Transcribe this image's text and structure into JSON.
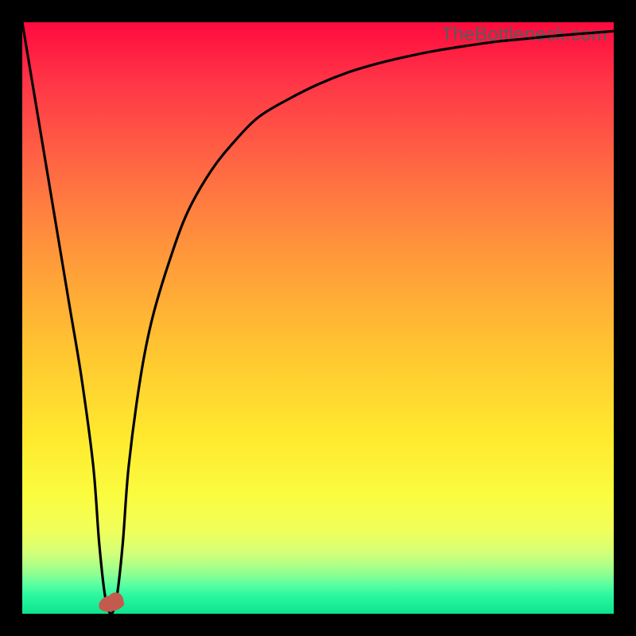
{
  "watermark": {
    "text": "TheBottleneck.com"
  },
  "chart_data": {
    "type": "line",
    "title": "",
    "xlabel": "",
    "ylabel": "",
    "xlim": [
      0,
      100
    ],
    "ylim": [
      0,
      100
    ],
    "grid": false,
    "legend": false,
    "background": "vertical gradient red→orange→yellow→green",
    "series": [
      {
        "name": "bottleneck-curve",
        "x": [
          0,
          2,
          4,
          6,
          8,
          10,
          12,
          13,
          14,
          15,
          16,
          17,
          18,
          20,
          22,
          25,
          28,
          32,
          36,
          40,
          45,
          50,
          55,
          60,
          65,
          70,
          75,
          80,
          85,
          90,
          95,
          100
        ],
        "y": [
          100,
          88,
          76,
          64,
          52,
          40,
          25,
          12,
          3,
          0,
          3,
          12,
          25,
          40,
          50,
          60,
          68,
          75,
          80,
          84,
          87,
          89.5,
          91.5,
          93,
          94.2,
          95.2,
          96,
          96.7,
          97.2,
          97.7,
          98.1,
          98.5
        ]
      }
    ],
    "marker": {
      "x": 15,
      "y": 1.5,
      "color": "#c35a4d"
    }
  }
}
